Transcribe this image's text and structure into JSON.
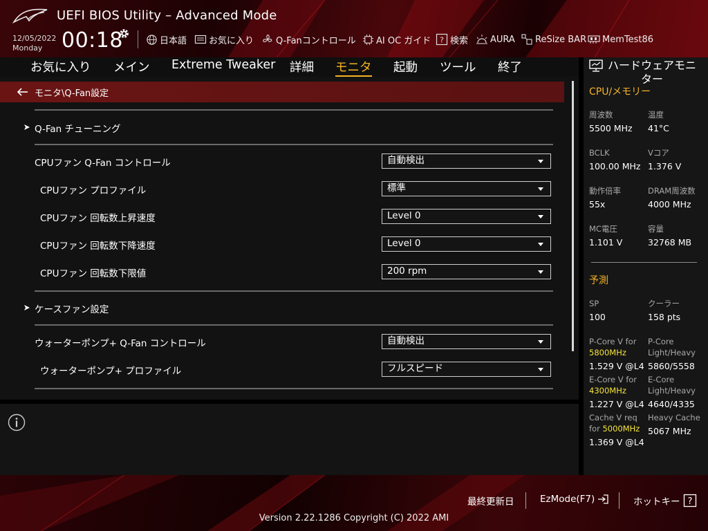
{
  "header": {
    "title": "UEFI BIOS Utility – Advanced Mode",
    "date": "12/05/2022",
    "weekday": "Monday",
    "time": "00:18",
    "tools": [
      {
        "icon": "globe-icon",
        "label": "日本語"
      },
      {
        "icon": "favorites-icon",
        "label": "お気に入り"
      },
      {
        "icon": "fan-icon",
        "label": "Q-Fanコントロール"
      },
      {
        "icon": "chip-icon",
        "label": "AI OC ガイド"
      },
      {
        "icon": "help-search-icon",
        "label": "検索"
      },
      {
        "icon": "aura-icon",
        "label": "AURA"
      },
      {
        "icon": "resize-bar-icon",
        "label": "ReSize BAR"
      },
      {
        "icon": "memtest-icon",
        "label": "MemTest86"
      }
    ]
  },
  "menu": [
    {
      "label": "お気に入り",
      "active": false
    },
    {
      "label": "メイン",
      "active": false
    },
    {
      "label": "Extreme Tweaker",
      "active": false
    },
    {
      "label": "詳細",
      "active": false
    },
    {
      "label": "モニタ",
      "active": true
    },
    {
      "label": "起動",
      "active": false
    },
    {
      "label": "ツール",
      "active": false
    },
    {
      "label": "終了",
      "active": false
    }
  ],
  "breadcrumb": "モニタ\\Q-Fan設定",
  "settings": {
    "qfan_tuning": "Q-Fan チューニング",
    "cpu_fan_control": {
      "label": "CPUファン Q-Fan コントロール",
      "value": "自動検出"
    },
    "cpu_fan_profile": {
      "label": "CPUファン プロファイル",
      "value": "標準"
    },
    "cpu_fan_step_up": {
      "label": "CPUファン 回転数上昇速度",
      "value": "Level 0"
    },
    "cpu_fan_step_down": {
      "label": "CPUファン 回転数下降速度",
      "value": "Level 0"
    },
    "cpu_fan_min_speed": {
      "label": "CPUファン 回転数下限値",
      "value": "200 rpm"
    },
    "case_fan": "ケースファン設定",
    "pump_control": {
      "label": "ウォーターポンプ+ Q-Fan コントロール",
      "value": "自動検出"
    },
    "pump_profile": {
      "label": "ウォーターポンプ+ プロファイル",
      "value": "フルスピード"
    }
  },
  "hw_monitor": {
    "title": "ハードウェアモニター",
    "cpu_section": "CPU/メモリー",
    "freq_label": "周波数",
    "freq_value": "5500 MHz",
    "temp_label": "温度",
    "temp_value": "41°C",
    "bclk_label": "BCLK",
    "bclk_value": "100.00 MHz",
    "vcore_label": "Vコア",
    "vcore_value": "1.376 V",
    "ratio_label": "動作倍率",
    "ratio_value": "55x",
    "dram_label": "DRAM周波数",
    "dram_value": "4000 MHz",
    "mc_label": "MC電圧",
    "mc_value": "1.101 V",
    "cap_label": "容量",
    "cap_value": "32768 MB",
    "predict_section": "予測",
    "sp_label": "SP",
    "sp_value": "100",
    "cooler_label": "クーラー",
    "cooler_value": "158 pts",
    "pcore_v_label": "P-Core V for",
    "pcore_v_freq": "5800MHz",
    "pcore_v_value": "1.529 V @L4",
    "pcore_lh_label1": "P-Core",
    "pcore_lh_label2": "Light/Heavy",
    "pcore_lh_value": "5860/5558",
    "ecore_v_label": "E-Core V for",
    "ecore_v_freq": "4300MHz",
    "ecore_v_value": "1.227 V @L4",
    "ecore_lh_label1": "E-Core",
    "ecore_lh_label2": "Light/Heavy",
    "ecore_lh_value": "4640/4335",
    "cache_v_label1": "Cache V req",
    "cache_v_label2": "for",
    "cache_v_freq": "5000MHz",
    "cache_v_value": "1.369 V @L4",
    "heavy_cache_label": "Heavy Cache",
    "heavy_cache_value": "5067 MHz"
  },
  "footer": {
    "last_modified": "最終更新日",
    "ezmode": "EzMode(F7)",
    "hotkey": "ホットキー",
    "version": "Version 2.22.1286 Copyright (C) 2022 AMI"
  },
  "colors": {
    "accent": "#f5b325",
    "breadcrumb": "#6b1414",
    "highlight": "#f5e33a"
  }
}
